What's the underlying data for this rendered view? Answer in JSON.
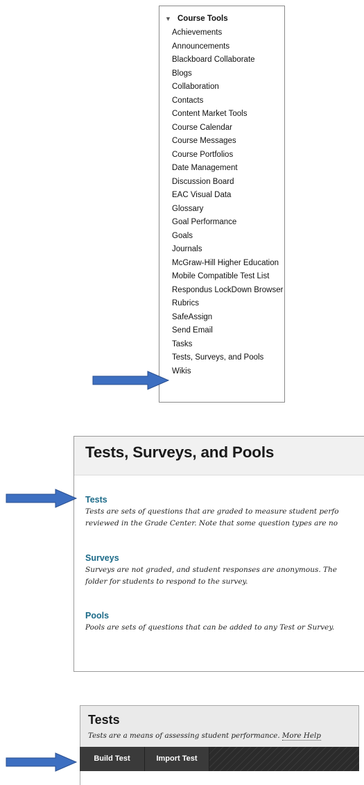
{
  "course_tools": {
    "caret": "▼",
    "title": "Course Tools",
    "items": [
      "Achievements",
      "Announcements",
      "Blackboard Collaborate",
      "Blogs",
      "Collaboration",
      "Contacts",
      "Content Market Tools",
      "Course Calendar",
      "Course Messages",
      "Course Portfolios",
      "Date Management",
      "Discussion Board",
      "EAC Visual Data",
      "Glossary",
      "Goal Performance",
      "Goals",
      "Journals",
      "McGraw-Hill Higher Education",
      "Mobile Compatible Test List",
      "Respondus LockDown Browser",
      "Rubrics",
      "SafeAssign",
      "Send Email",
      "Tasks",
      "Tests, Surveys, and Pools",
      "Wikis"
    ]
  },
  "tsp_page": {
    "title": "Tests, Surveys, and Pools",
    "tests": {
      "label": "Tests",
      "desc_line1": "Tests are sets of questions that are graded to measure student perfo",
      "desc_line2": "reviewed in the Grade Center. Note that some question types are no"
    },
    "surveys": {
      "label": "Surveys",
      "desc_line1": "Surveys are not graded, and student responses are anonymous. The",
      "desc_line2": "folder for students to respond to the survey."
    },
    "pools": {
      "label": "Pools",
      "desc_line1": "Pools are sets of questions that can be added to any Test or Survey."
    }
  },
  "tests_page": {
    "title": "Tests",
    "subtitle": "Tests are a means of assessing student performance.",
    "help_link": "More Help",
    "toolbar": {
      "build_label": "Build Test",
      "import_label": "Import Test"
    }
  },
  "colors": {
    "link": "#1b6a88",
    "arrow_fill": "#3d6fc1",
    "arrow_stroke": "#2a4f8f",
    "toolbar_bg": "#2a2a2a"
  },
  "icons": {
    "pointer_arrow": "right-arrow-icon",
    "collapse_caret": "caret-down-icon"
  }
}
